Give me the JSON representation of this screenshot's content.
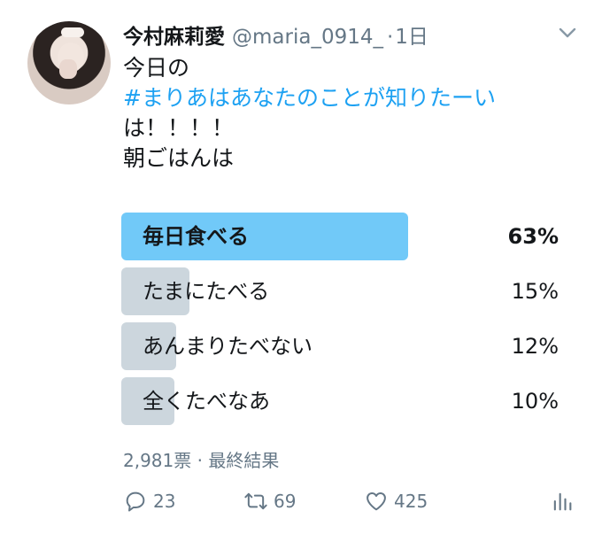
{
  "tweet": {
    "author_name": "今村麻莉愛",
    "handle": "@maria_0914_",
    "separator": "·",
    "time": "1日",
    "text_lines": [
      "今日の",
      "#まりあはあなたのことが知りたーい",
      "は！！！！",
      "朝ごはんは"
    ]
  },
  "poll": {
    "options": [
      {
        "label": "毎日食べる",
        "percent_label": "63%",
        "percent": 63
      },
      {
        "label": "たまにたべる",
        "percent_label": "15%",
        "percent": 15
      },
      {
        "label": "あんまりたべない",
        "percent_label": "12%",
        "percent": 12
      },
      {
        "label": "全くたべなあ",
        "percent_label": "10%",
        "percent": 10
      }
    ],
    "meta": "2,981票 · 最終結果"
  },
  "actions": {
    "reply_count": "23",
    "retweet_count": "69",
    "like_count": "425"
  },
  "icons": {
    "reply": "reply-icon",
    "retweet": "retweet-icon",
    "like": "heart-icon",
    "stats": "analytics-icon",
    "menu": "chevron-down-icon"
  },
  "colors": {
    "accent": "#1da1f2",
    "winner_bar": "#71c9f8",
    "bar": "#ccd6dd",
    "muted": "#657786"
  }
}
